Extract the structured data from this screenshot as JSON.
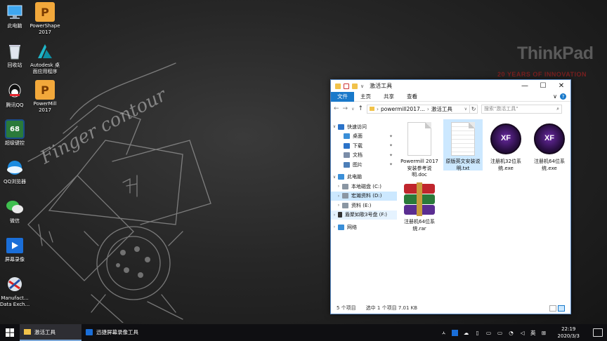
{
  "wallpaper": {
    "brand": "ThinkPad",
    "tagline": "20 YEARS OF INNOVATION",
    "sketch_text": "Finger contour"
  },
  "desktop_icons": [
    {
      "label": "此电脑",
      "icon": "this-pc-icon"
    },
    {
      "label": "PowerShape 2017",
      "icon": "powershape-icon"
    },
    {
      "label": "回收站",
      "icon": "recycle-bin-icon"
    },
    {
      "label": "Autodesk 桌面应用程序",
      "icon": "autodesk-icon"
    },
    {
      "label": "腾讯QQ",
      "icon": "qq-icon"
    },
    {
      "label": "PowerMill 2017",
      "icon": "powermill-icon"
    },
    {
      "label": "超级键控",
      "icon": "super-key-icon"
    },
    {
      "label": "QQ浏览器",
      "icon": "qq-browser-icon"
    },
    {
      "label": "微信",
      "icon": "wechat-icon"
    },
    {
      "label": "屏幕录像",
      "icon": "screen-record-icon"
    },
    {
      "label": "Manufact... Data Exch...",
      "icon": "manufacturing-data-exchange-icon"
    }
  ],
  "explorer": {
    "title": "激活工具",
    "qa_chevron": "∨",
    "controls": {
      "minimize": "—",
      "maximize": "☐",
      "close": "✕"
    },
    "ribbon_tabs": [
      "文件",
      "主页",
      "共享",
      "查看"
    ],
    "ribbon_expand": "∨",
    "help": "?",
    "nav": {
      "back": "←",
      "forward": "→",
      "dropdown": "∨",
      "up": "↑"
    },
    "address": {
      "segments": [
        "powermill2017...",
        "激活工具"
      ],
      "sep": "›",
      "lead": "›",
      "dd": "∨"
    },
    "refresh": "↻",
    "search_placeholder": "搜索\"激活工具\"",
    "search_icon": "⌕",
    "pin": "✦",
    "navpane": [
      {
        "label": "快速访问",
        "exp": "∨",
        "icon": "star-icon",
        "color": "#2b73c9",
        "indent": 1
      },
      {
        "label": "桌面",
        "exp": "",
        "icon": "desktop-folder-icon",
        "color": "#3a8fd8",
        "indent": 2,
        "pinned": true
      },
      {
        "label": "下载",
        "exp": "",
        "icon": "download-icon",
        "color": "#2b73c9",
        "indent": 2,
        "pinned": true
      },
      {
        "label": "文档",
        "exp": "",
        "icon": "documents-icon",
        "color": "#7b8da8",
        "indent": 2,
        "pinned": true
      },
      {
        "label": "图片",
        "exp": "",
        "icon": "pictures-icon",
        "color": "#4d7fb8",
        "indent": 2,
        "pinned": true
      },
      {
        "label": "此电脑",
        "exp": "∨",
        "icon": "this-pc-icon",
        "color": "#3a8fd8",
        "indent": 1
      },
      {
        "label": "本地磁盘 (C:)",
        "exp": "›",
        "icon": "drive-icon",
        "color": "#8a96a3",
        "indent": 2
      },
      {
        "label": "宏瀚资料 (D:)",
        "exp": "›",
        "icon": "drive-icon",
        "color": "#8a96a3",
        "indent": 2,
        "selected": true
      },
      {
        "label": "资料 (E:)",
        "exp": "›",
        "icon": "drive-icon",
        "color": "#8a96a3",
        "indent": 2
      },
      {
        "label": "盾聚如歌3号盘 (F:)",
        "exp": "›",
        "icon": "usb-drive-icon",
        "color": "#333333",
        "indent": 1,
        "hover": true
      },
      {
        "label": "网络",
        "exp": "›",
        "icon": "network-icon",
        "color": "#3a8fd8",
        "indent": 1
      }
    ],
    "files": [
      {
        "name": "Powermill 2017 安装参考说明.doc",
        "kind": "doc",
        "selected": false
      },
      {
        "name": "原版英文安装说明.txt",
        "kind": "txt",
        "selected": true
      },
      {
        "name": "注册机32位系统.exe",
        "kind": "xf",
        "badge": "XF",
        "selected": false
      },
      {
        "name": "注册机64位系统.exe",
        "kind": "xf",
        "badge": "XF",
        "selected": false
      },
      {
        "name": "注册机64位系统.rar",
        "kind": "rar",
        "selected": false
      }
    ],
    "status": {
      "count": "5 个项目",
      "selection": "选中 1 个项目  7.01 KB"
    }
  },
  "taskbar": {
    "buttons": [
      {
        "label": "激活工具",
        "icon": "folder-icon",
        "active": true
      },
      {
        "label": "迅捷屏幕录像工具",
        "icon": "screen-recorder-icon",
        "active": false
      }
    ],
    "tray": {
      "chevron": "ㅅ",
      "ime": "英",
      "keyboard": "⊞"
    },
    "clock": {
      "time": "22:19",
      "date": "2020/3/3"
    }
  }
}
